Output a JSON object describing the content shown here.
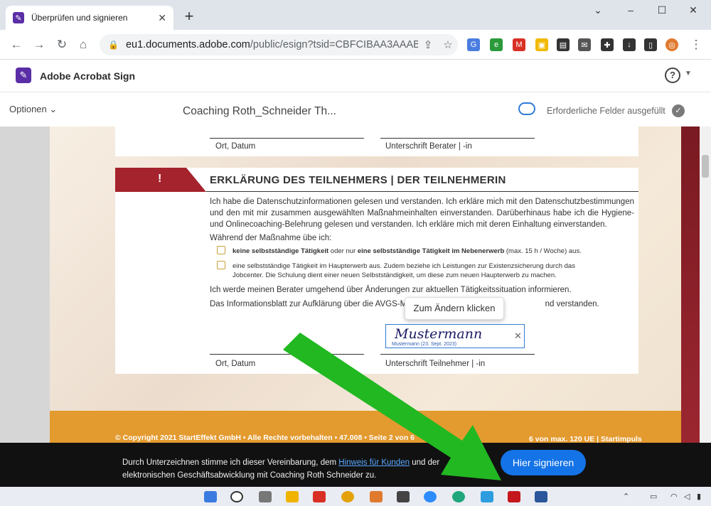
{
  "browser": {
    "tab_title": "Überprüfen und signieren",
    "url_host": "eu1.documents.adobe.com",
    "url_path": "/public/esign?tsid=CBFCIBAA3AAABLb..."
  },
  "app": {
    "name": "Adobe Acrobat Sign",
    "help": "?"
  },
  "subbar": {
    "options_label": "Optionen",
    "doc_title": "Coaching Roth_Schneider Th...",
    "required_status": "Erforderliche Felder ausgefüllt"
  },
  "document": {
    "top_labels": {
      "left": "Ort, Datum",
      "right": "Unterschrift Berater | -in"
    },
    "section": {
      "badge": "!",
      "title": "ERKLÄRUNG DES TEILNEHMERS | DER TEILNEHMERIN",
      "para1": "Ich habe die Datenschutzinformationen gelesen und verstanden. Ich erkläre mich mit den Datenschutzbestimmungen und den mit mir zusammen ausgewählten Maßnahmeinhalten einverstanden. Darüberhinaus habe ich die Hygiene- und Onlinecoaching-Belehrung gelesen und verstanden. Ich erkläre mich mit deren Einhaltung einverstanden.",
      "during": "Während der Maßnahme übe ich:",
      "option1_bold_a": "keine selbstständige Tätigkeit",
      "option1_mid": " oder nur ",
      "option1_bold_b": "eine selbstständige Tätigkeit im Nebenerwerb",
      "option1_tail": " (max. 15 h / Woche) aus.",
      "option2": "eine selbstständige Tätigkeit im Haupterwerb aus. Zudem beziehe ich Leistungen zur Existenzsicherung durch das Jobcenter. Die Schulung dient einer neuen Selbstständigkeit, um diese zum neuen Haupterwerb zu machen.",
      "para2": "Ich werde meinen Berater umgehend über Änderungen zur aktuellen Tätigkeitssituation informieren.",
      "para3_a": "Das Informationsblatt zur Aufklärung über die AVGS-Ma",
      "para3_b": "nd verstanden.",
      "sig_name": "Mustermann",
      "sig_caption": "Mustermann    (23. Sept. 2023)",
      "tooltip": "Zum Ändern klicken",
      "bottom_left": "Ort, Datum",
      "bottom_right": "Unterschrift Teilnehmer | -in"
    },
    "footer_left": "© Copyright 2021 StartEffekt GmbH • Alle Rechte vorbehalten • 47.008 • Seite 2 von 6",
    "footer_right": "6  von max. 120 UE | Startimpuls"
  },
  "consent": {
    "text_a": "Durch Unterzeichnen stimme ich dieser Vereinbarung, dem ",
    "link": "Hinweis für Kunden",
    "text_b": " und der elektronischen Geschäftsabwicklung mit Coaching Roth Schneider zu.",
    "button": "Hier signieren"
  },
  "colors": {
    "accent": "#1473e6",
    "banner_red": "#a4232d",
    "arrow_green": "#22b822",
    "footer_orange": "#e39a2e"
  }
}
